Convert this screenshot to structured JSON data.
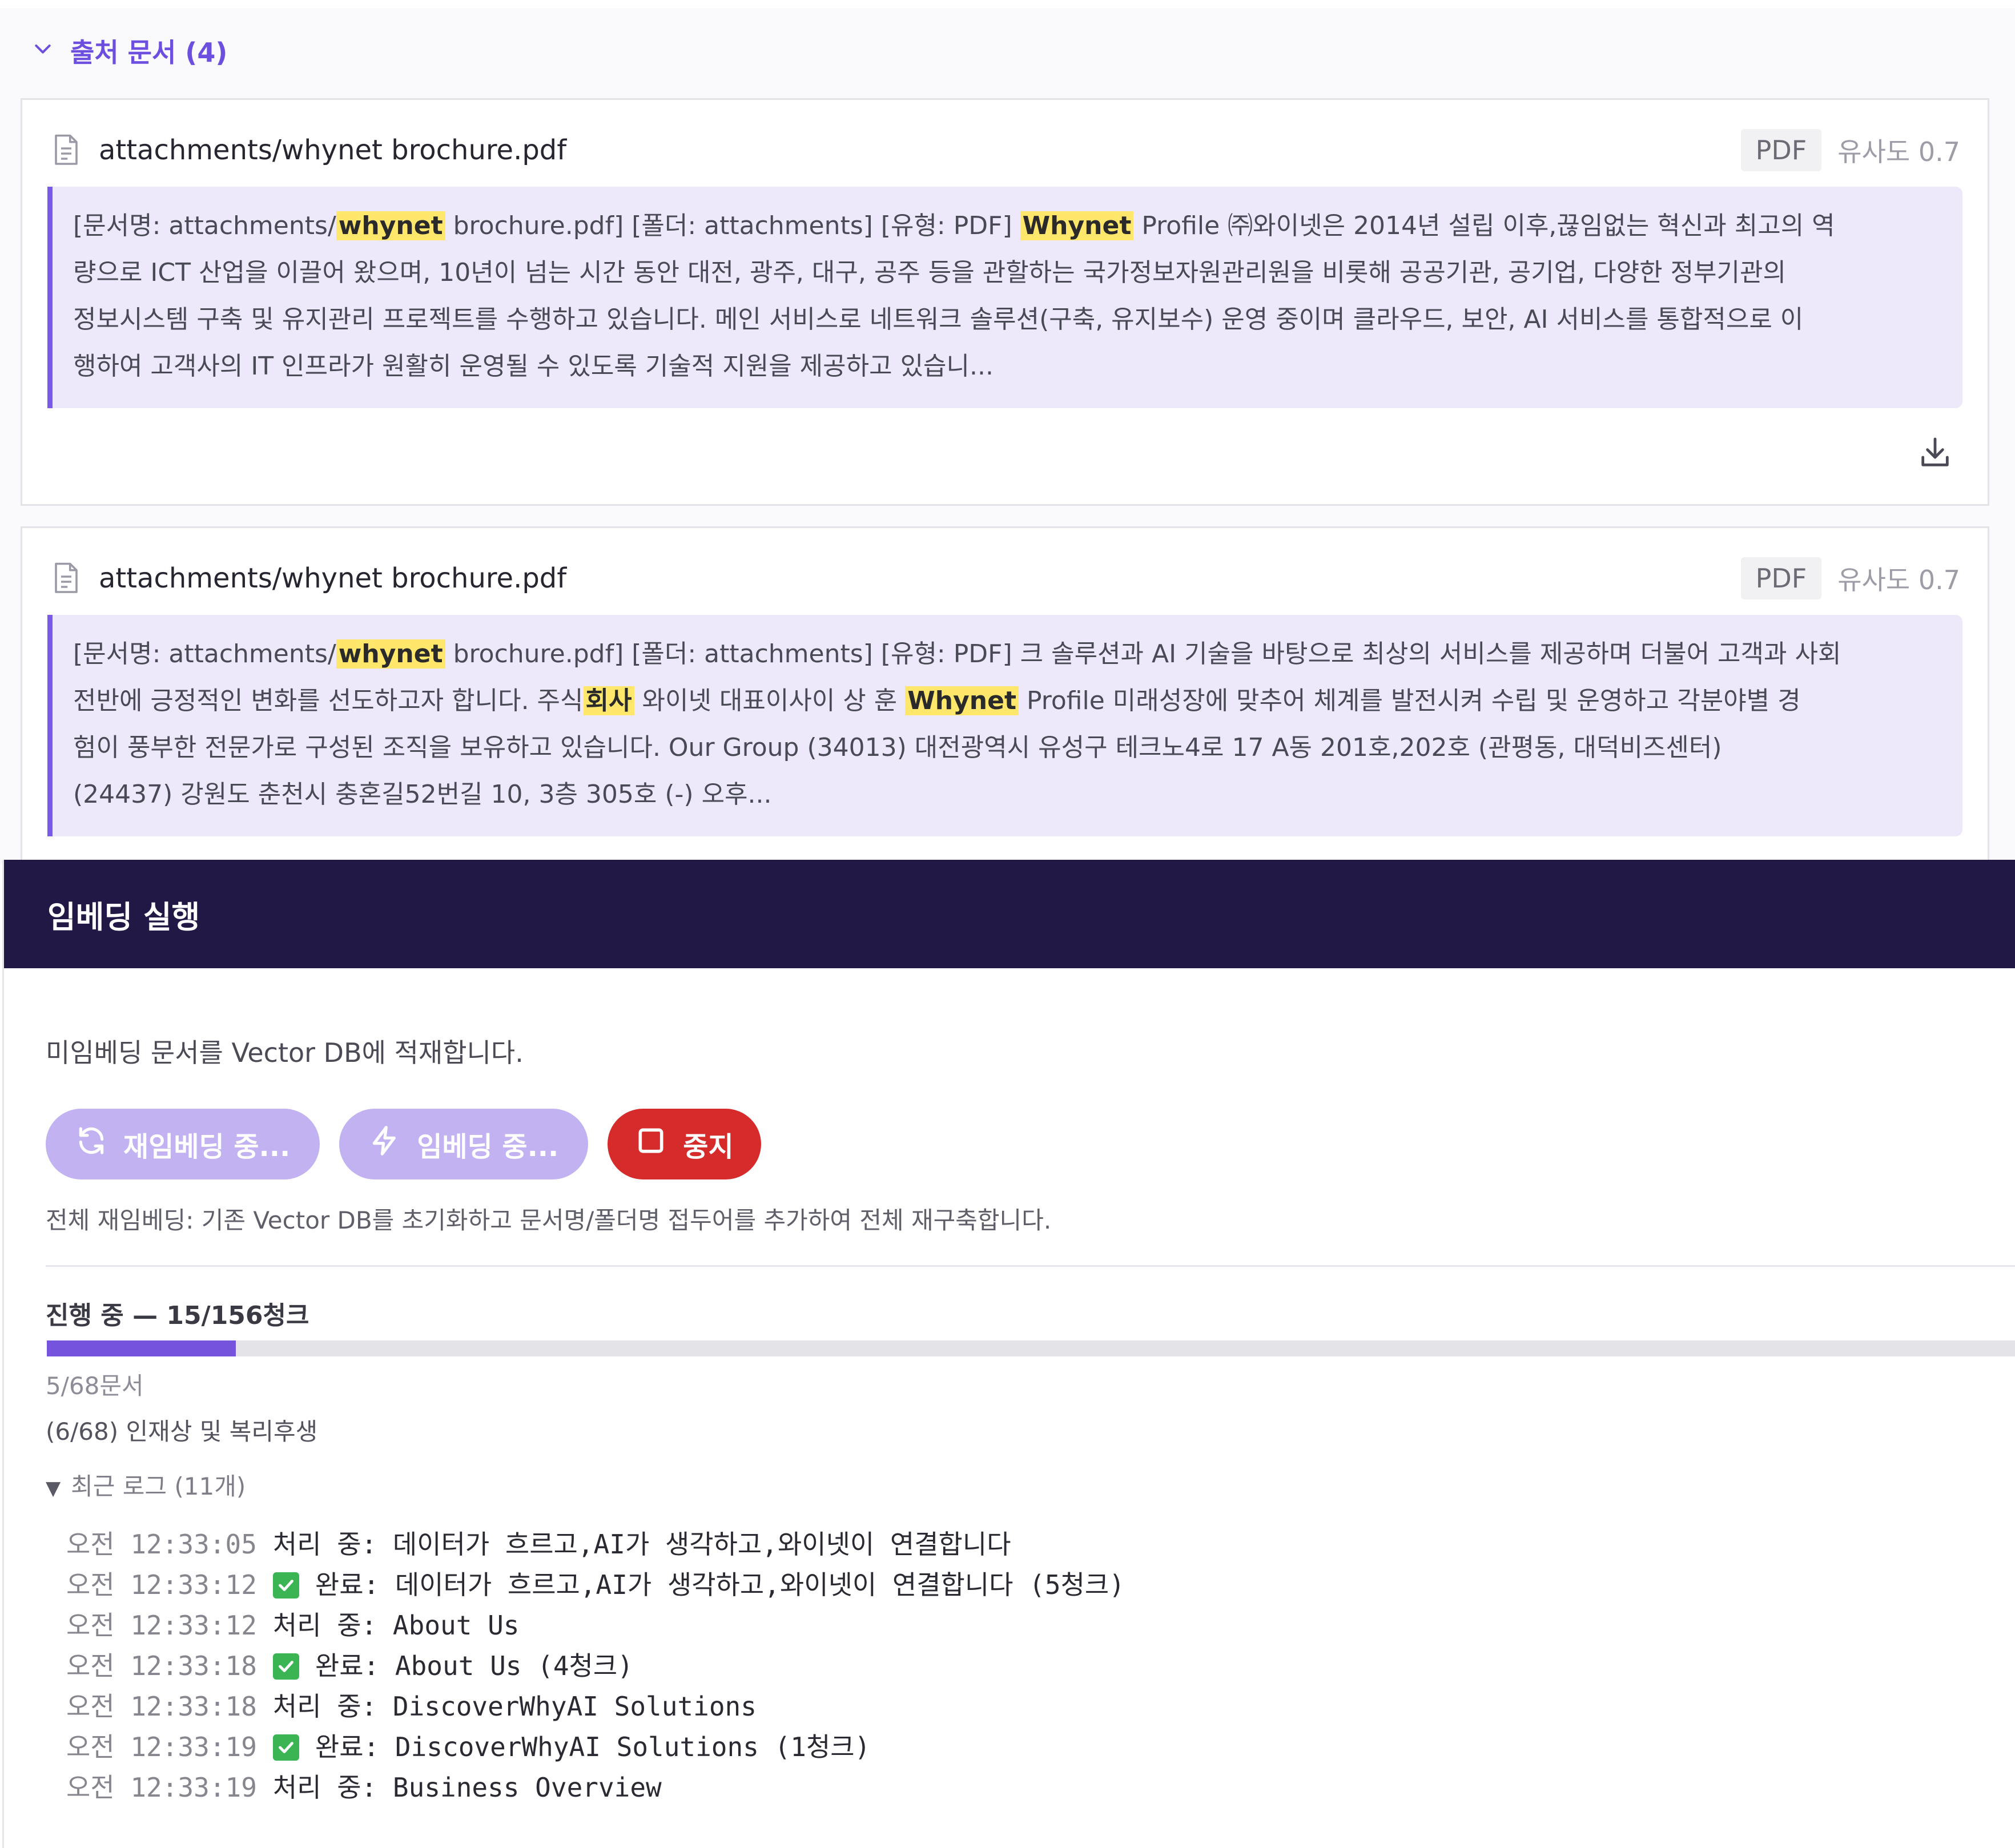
{
  "sources": {
    "header": "출처 문서 (4)",
    "cards": [
      {
        "title": "attachments/whynet brochure.pdf",
        "type": "PDF",
        "score": "유사도 0.7",
        "lines": [
          [
            {
              "t": "[문서명: attachments/"
            },
            {
              "t": "whynet",
              "hl": true
            },
            {
              "t": " brochure.pdf] [폴더: attachments] [유형: PDF] "
            },
            {
              "t": "Whynet",
              "hl": true
            },
            {
              "t": " Profile ㈜와이넷은 2014년 설립 이후,끊임없는 혁신과 최고의 역"
            }
          ],
          [
            {
              "t": "량으로 ICT 산업을 이끌어 왔으며, 10년이 넘는 시간 동안 대전, 광주, 대구, 공주 등을 관할하는 국가정보자원관리원을 비롯해 공공기관, 공기업, 다양한 정부기관의"
            }
          ],
          [
            {
              "t": "정보시스템 구축 및 유지관리 프로젝트를 수행하고 있습니다. 메인 서비스로 네트워크 솔루션(구축, 유지보수) 운영 중이며 클라우드, 보안, AI 서비스를 통합적으로 이"
            }
          ],
          [
            {
              "t": "행하여 고객사의 IT 인프라가 원활히 운영될 수 있도록 기술적 지원을 제공하고 있습니..."
            }
          ]
        ]
      },
      {
        "title": "attachments/whynet brochure.pdf",
        "type": "PDF",
        "score": "유사도 0.7",
        "lines": [
          [
            {
              "t": "[문서명: attachments/"
            },
            {
              "t": "whynet",
              "hl": true
            },
            {
              "t": " brochure.pdf] [폴더: attachments] [유형: PDF] 크 솔루션과 AI 기술을 바탕으로 최상의 서비스를 제공하며 더불어 고객과 사회"
            }
          ],
          [
            {
              "t": "전반에 긍정적인 변화를 선도하고자 합니다. 주식"
            },
            {
              "t": "회사",
              "hl": true
            },
            {
              "t": " 와이넷 대표이사이 상 훈 "
            },
            {
              "t": "Whynet",
              "hl": true
            },
            {
              "t": " Profile 미래성장에 맞추어 체계를 발전시켜 수립 및 운영하고 각분야별 경"
            }
          ],
          [
            {
              "t": "험이 풍부한 전문가로 구성된 조직을 보유하고 있습니다. Our Group (34013) 대전광역시 유성구 테크노4로 17 A동 201호,202호 (관평동, 대덕비즈센터)"
            }
          ],
          [
            {
              "t": "(24437) 강원도 춘천시 충혼길52번길 10, 3층 305호 (-) 오후..."
            }
          ]
        ]
      }
    ]
  },
  "embedding": {
    "title": "임베딩 실행",
    "description": "미임베딩 문서를 Vector DB에 적재합니다.",
    "reembed_label": "재임베딩 중...",
    "embed_label": "임베딩 중...",
    "stop_label": "중지",
    "note": "전체 재임베딩: 기존 Vector DB를 초기화하고 문서명/폴더명 접두어를 추가하여 전체 재구축합니다.",
    "progress_text": "진행 중 — 15/156청크",
    "progress_done": 15,
    "progress_total": 156,
    "docs_count": "5/68문서",
    "current_doc": "(6/68) 인재상 및 복리후생",
    "log_toggle": "최근 로그 (11개)",
    "logs": [
      {
        "time": "오전 12:33:05",
        "done": false,
        "text": "처리 중: 데이터가 흐르고,AI가 생각하고,와이넷이 연결합니다"
      },
      {
        "time": "오전 12:33:12",
        "done": true,
        "text": "완료: 데이터가 흐르고,AI가 생각하고,와이넷이 연결합니다 (5청크)"
      },
      {
        "time": "오전 12:33:12",
        "done": false,
        "text": "처리 중: About Us"
      },
      {
        "time": "오전 12:33:18",
        "done": true,
        "text": "완료: About Us (4청크)"
      },
      {
        "time": "오전 12:33:18",
        "done": false,
        "text": "처리 중: DiscoverWhyAI Solutions"
      },
      {
        "time": "오전 12:33:19",
        "done": true,
        "text": "완료: DiscoverWhyAI Solutions (1청크)"
      },
      {
        "time": "오전 12:33:19",
        "done": false,
        "text": "처리 중: Business Overview"
      }
    ]
  },
  "colors": {
    "accent": "#7653dc",
    "header_bg": "#221845",
    "stop": "#d62b2b",
    "highlight": "#ffe76b",
    "success": "#3bb554"
  },
  "icons": [
    "chevron-down-icon",
    "document-icon",
    "download-icon",
    "refresh-icon",
    "lightning-icon",
    "stop-square-icon",
    "check-icon"
  ]
}
